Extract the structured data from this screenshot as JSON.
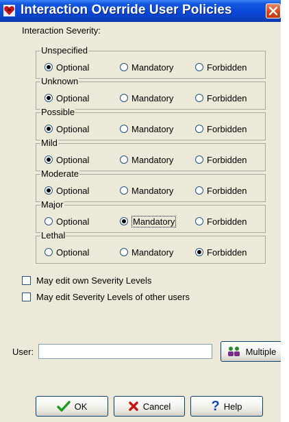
{
  "window": {
    "title": "Interaction Override User Policies"
  },
  "severity_section_label": "Interaction Severity:",
  "options": {
    "optional": "Optional",
    "mandatory": "Mandatory",
    "forbidden": "Forbidden"
  },
  "groups": [
    {
      "name": "Unspecified",
      "selected": "optional"
    },
    {
      "name": "Unknown",
      "selected": "optional"
    },
    {
      "name": "Possible",
      "selected": "optional"
    },
    {
      "name": "Mild",
      "selected": "optional"
    },
    {
      "name": "Moderate",
      "selected": "optional"
    },
    {
      "name": "Major",
      "selected": "mandatory"
    },
    {
      "name": "Lethal",
      "selected": "forbidden"
    }
  ],
  "checkboxes": [
    {
      "label": "May edit own Severity Levels",
      "checked": false
    },
    {
      "label": "May edit Severity Levels of other users",
      "checked": false
    }
  ],
  "user": {
    "label": "User:",
    "value": ""
  },
  "buttons": {
    "multiple": "Multiple",
    "ok": "OK",
    "cancel": "Cancel",
    "help": "Help"
  }
}
